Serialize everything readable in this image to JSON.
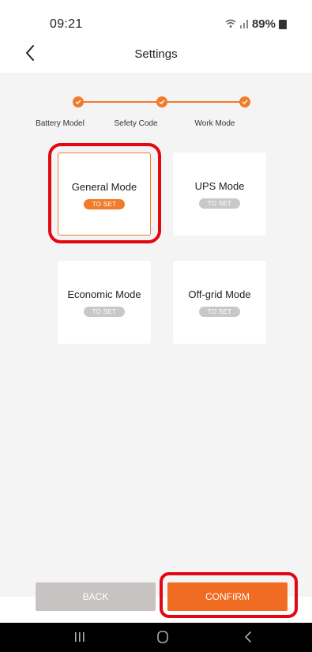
{
  "status_bar": {
    "time": "09:21",
    "battery": "89%",
    "icons": [
      "wifi-icon",
      "signal-icon",
      "battery-icon"
    ]
  },
  "header": {
    "title": "Settings",
    "back_icon": "chevron-left-icon"
  },
  "stepper": {
    "steps": [
      {
        "label": "Battery Model",
        "done": true
      },
      {
        "label": "Sefety Code",
        "done": true
      },
      {
        "label": "Work Mode",
        "done": true
      }
    ]
  },
  "modes": [
    {
      "name": "General Mode",
      "action": "TO SET",
      "selected": true
    },
    {
      "name": "UPS Mode",
      "action": "TO SET",
      "selected": false
    },
    {
      "name": "Economic Mode",
      "action": "TO SET",
      "selected": false
    },
    {
      "name": "Off-grid Mode",
      "action": "TO SET",
      "selected": false
    }
  ],
  "actions": {
    "back": "BACK",
    "confirm": "CONFIRM"
  },
  "navbar": {
    "icons": [
      "recent-apps-icon",
      "home-icon",
      "back-icon"
    ]
  },
  "colors": {
    "accent": "#f07b2a",
    "highlight": "#e30613",
    "disabled": "#c8c8c8",
    "back_button": "#c7c3c3"
  }
}
